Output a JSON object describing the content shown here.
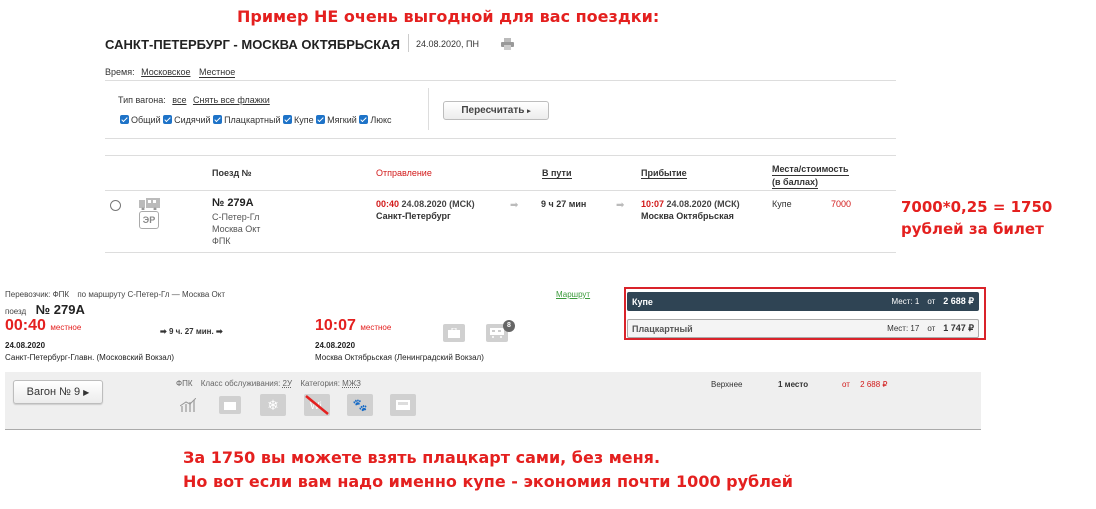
{
  "note_top": "Пример НЕ очень выгодной для вас поездки:",
  "header": {
    "route": "САНКТ-ПЕТЕРБУРГ - МОСКВА ОКТЯБРЬСКАЯ",
    "date": "24.08.2020, ПН"
  },
  "time_toggle": {
    "label": "Время:",
    "msk": "Московское",
    "local": "Местное"
  },
  "filters": {
    "wagon_type_label": "Тип вагона:",
    "all": "все",
    "clear": "Снять все флажки",
    "options": [
      "Общий",
      "Сидячий",
      "Плацкартный",
      "Купе",
      "Мягкий",
      "Люкс"
    ],
    "recalc": "Пересчитать"
  },
  "table": {
    "headers": {
      "train": "Поезд №",
      "departure": "Отправление",
      "duration": "В пути",
      "arrival": "Прибытие",
      "seats": "Места/стоимость",
      "seats2": "(в баллах)"
    },
    "row": {
      "train_no": "№ 279А",
      "from_short": "С-Петер-Гл",
      "to_short": "Москва Окт",
      "carrier": "ФПК",
      "er": "ЭР",
      "dep_time": "00:40",
      "dep_date": "24.08.2020 (МСК)",
      "dep_station": "Санкт-Петербург",
      "duration": "9 ч 27 мин",
      "arr_time": "10:07",
      "arr_date": "24.08.2020 (МСК)",
      "arr_station": "Москва Октябрьская",
      "class": "Купе",
      "price": "7000"
    }
  },
  "note_calc": {
    "line1": "7000*0,25 = 1750",
    "line2": "рублей за билет"
  },
  "detail": {
    "carrier_label": "Перевозчик: ФПК",
    "route_label": "по маршруту С-Петер-Гл — Москва Окт",
    "route_link": "Маршрут",
    "train_label": "поезд",
    "train_no": "№ 279А",
    "dep_time": "00:40",
    "local": "местное",
    "dep_date": "24.08.2020",
    "dep_station": "Санкт-Петербург-Главн. (Московский Вокзал)",
    "duration": "9 ч. 27 мин.",
    "arr_time": "10:07",
    "arr_date": "24.08.2020",
    "arr_station": "Москва Октябрьская (Ленинградский Вокзал)",
    "badge": "8"
  },
  "fares": [
    {
      "name": "Купе",
      "seats": "Мест: 1",
      "from": "от",
      "price": "2 688 ₽"
    },
    {
      "name": "Плацкартный",
      "seats": "Мест: 17",
      "from": "от",
      "price": "1 747 ₽"
    }
  ],
  "wagon": {
    "button": "Вагон  № 9",
    "carrier": "ФПК",
    "service_label": "Класс обслуживания:",
    "service": "2У",
    "category_label": "Категория:",
    "category": "МЖЗ",
    "berth": "Верхнее",
    "count": "1 место",
    "from": "от",
    "price": "2 688 ₽"
  },
  "note_bottom": {
    "line1": "За 1750 вы можете взять плацкарт сами, без меня.",
    "line2": "Но вот если вам надо именно купе - экономия почти 1000 рублей"
  },
  "colors": {
    "accent_red": "#e4201f",
    "checkbox": "#1e73c8",
    "fare_header": "#2f4454",
    "price_red": "#d21a1a"
  }
}
